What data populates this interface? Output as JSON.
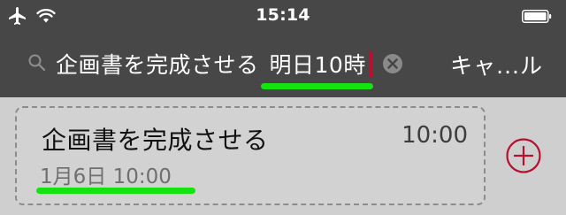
{
  "status_bar": {
    "time": "15:14",
    "icons": [
      "airplane-icon",
      "wifi-icon",
      "battery-icon"
    ]
  },
  "search": {
    "query_base": "企画書を完成させる",
    "query_highlight": "明日10時",
    "cancel_label": "キャ...ル"
  },
  "result": {
    "title": "企画書を完成させる",
    "time": "10:00",
    "date": "1月6日 10:00"
  },
  "colors": {
    "header_background": "#474747",
    "list_background": "#cfcfcf",
    "highlight_underline": "#13e30f",
    "caret": "#b6112f",
    "add_button": "#b6112f"
  }
}
